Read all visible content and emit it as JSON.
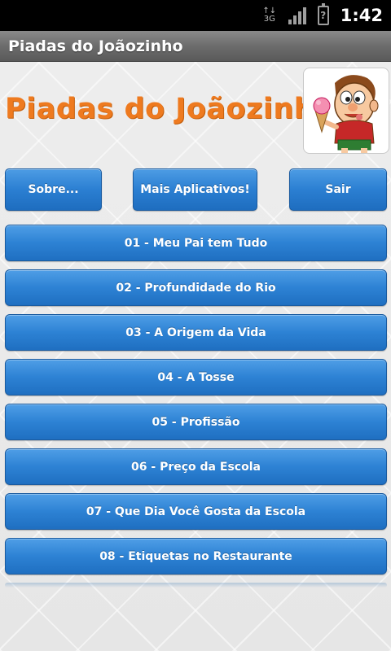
{
  "status_bar": {
    "network": "3G",
    "battery_glyph": "?",
    "time": "1:42"
  },
  "title_bar": {
    "title": "Piadas do Joãozinho"
  },
  "header": {
    "logo_text": "Piadas do Joãozinho",
    "mascot_icon": "boy-with-ice-cream-icon"
  },
  "buttons": {
    "sobre": "Sobre...",
    "mais": "Mais Aplicativos!",
    "sair": "Sair"
  },
  "jokes": [
    "01 - Meu Pai tem Tudo",
    "02 - Profundidade do Rio",
    "03 - A Origem da Vida",
    "04 - A Tosse",
    "05 - Profissão",
    "06 - Preço da Escola",
    "07 - Que Dia Você Gosta da Escola",
    "08 - Etiquetas no Restaurante"
  ],
  "colors": {
    "accent_orange": "#ee7a1f",
    "button_blue": "#2b7fd2"
  }
}
